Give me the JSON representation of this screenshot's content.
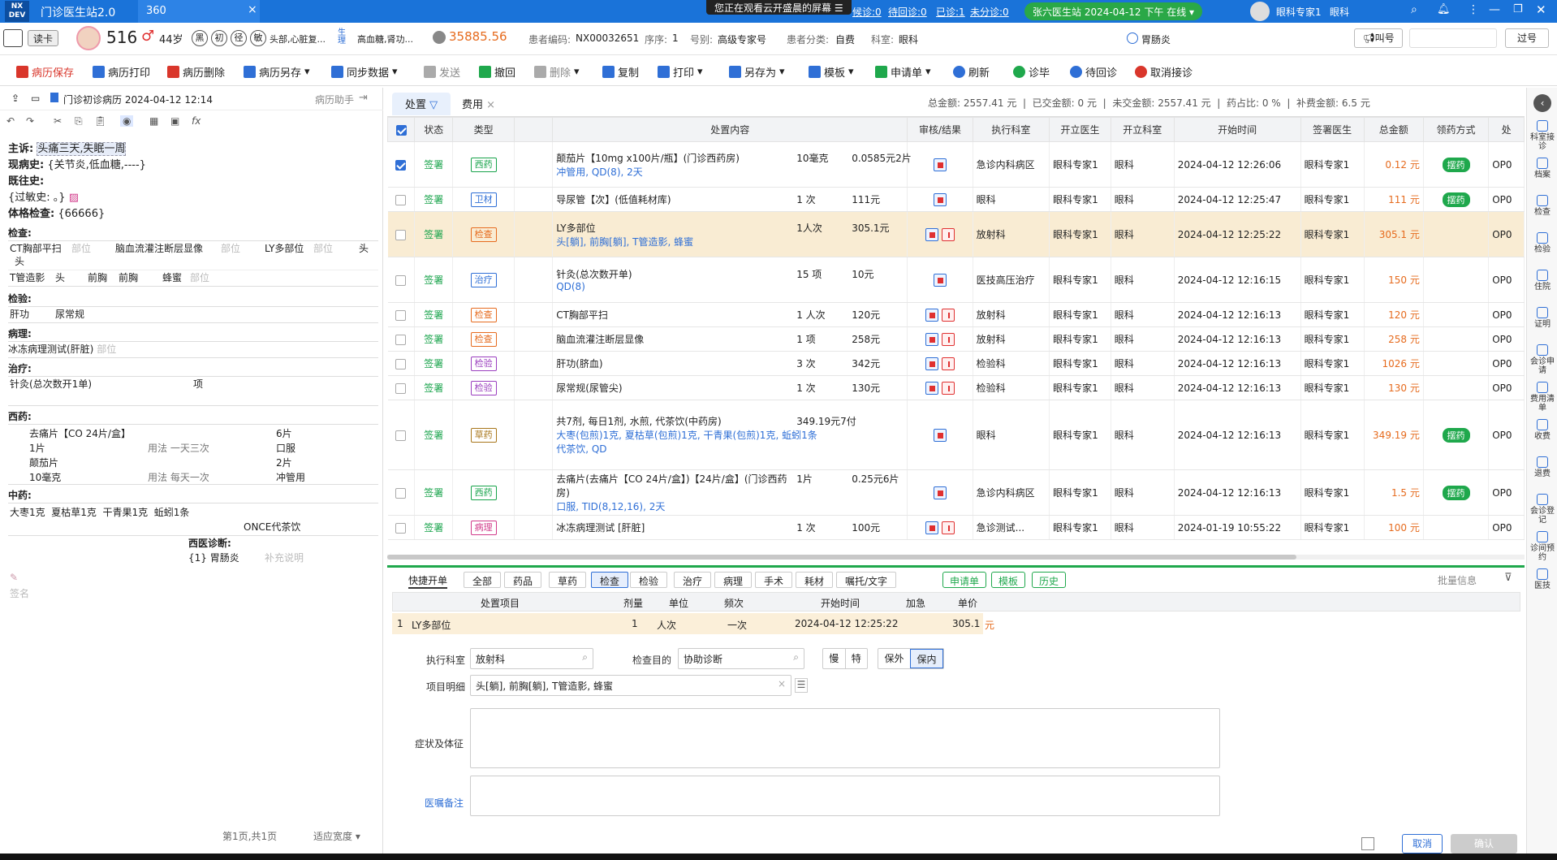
{
  "titlebar": {
    "logo": "NX DEV",
    "app_title": "门诊医生站2.0",
    "tab2_label": "360",
    "share_notice": "您正在观看云开盛晨的屏幕",
    "counts": [
      "候诊:0",
      "待回诊:0",
      "已诊:1",
      "未分诊:0"
    ],
    "online_label": "张六医生站 2024-04-12 下午",
    "online_status": "在线",
    "user_label": "眼科专家1",
    "user_dept": "眼科"
  },
  "patient": {
    "read_card": "读卡",
    "visit_num": "516",
    "gender_symbol": "♂",
    "age": "44岁",
    "badges": [
      "黑",
      "初",
      "径",
      "敏"
    ],
    "allergy": "头部,心脏复...",
    "diag": "高血糖,肾功...",
    "balance": "35885.56",
    "code_label": "患者编码:",
    "code": "NX00032651",
    "seq_label": "序序:",
    "seq": "1",
    "reg_label": "号别:",
    "reg": "高级专家号",
    "cat_label": "患者分类:",
    "cat": "自费",
    "dept_label": "科室:",
    "dept": "眼科",
    "flag": "胃肠炎",
    "call_btn": "叫号",
    "pass_btn": "过号"
  },
  "toolbar": {
    "items": [
      {
        "label": "病历保存",
        "color": "#d9362b"
      },
      {
        "label": "病历打印",
        "color": "#2f6fd6"
      },
      {
        "label": "病历删除",
        "color": "#d9362b"
      },
      {
        "label": "病历另存",
        "color": "#2f6fd6"
      },
      {
        "label": "同步数据",
        "color": "#2f6fd6"
      },
      {
        "label": "发送",
        "color": "#777777"
      },
      {
        "label": "撤回",
        "color": "#1fa84c"
      },
      {
        "label": "删除",
        "color": "#777777"
      },
      {
        "label": "复制",
        "color": "#2f6fd6"
      },
      {
        "label": "打印",
        "color": "#2f6fd6"
      },
      {
        "label": "另存为",
        "color": "#2f6fd6"
      },
      {
        "label": "模板",
        "color": "#2f6fd6"
      },
      {
        "label": "申请单",
        "color": "#1fa84c"
      },
      {
        "label": "刷新",
        "color": "#2f6fd6"
      },
      {
        "label": "诊毕",
        "color": "#1fa84c"
      },
      {
        "label": "待回诊",
        "color": "#2f6fd6"
      },
      {
        "label": "取消接诊",
        "color": "#d9362b"
      }
    ]
  },
  "record": {
    "title": "门诊初诊病历 2024-04-12 12:14",
    "assistant": "病历助手",
    "chief_label": "主诉:",
    "chief": "头痛三天,失眠一周",
    "hpi_label": "现病史:",
    "hpi": "{关节炎,低血糖,----}",
    "past_label": "既往史:",
    "allergy_label": "{过敏史:",
    "allergy_val": "。}",
    "exam_label": "体格检查:",
    "exam_val": "{66666}",
    "check_label": "检查:",
    "checks": [
      "CT胸部平扫",
      "脑血流灌注断层显像",
      "LY多部位",
      "T管造影",
      "头",
      "前胸",
      "前胸",
      "蜂蜜"
    ],
    "lab_label": "检验:",
    "labs": [
      "肝功",
      "尿常规"
    ],
    "path_label": "病理:",
    "path_val": "冰冻病理测试(肝脏)",
    "treat_label": "治疗:",
    "treat_val": "针灸(总次数开1单)",
    "treat_unit": "项",
    "west_label": "西药:",
    "west": [
      [
        "去痛片【CO 24片/盒】",
        "6片"
      ],
      [
        "1片",
        "用法 一天三次",
        "口服"
      ],
      [
        "颠茄片",
        "2片"
      ],
      [
        "10毫克",
        "用法 每天一次",
        "冲管用"
      ]
    ],
    "chinese_label": "中药:",
    "chinese": "大枣1克  夏枯草1克  干青果1克  蚯蚓1条",
    "chinese_note": "ONCE代茶饮",
    "diag_label": "西医诊断:",
    "diag_val": "{1} 胃肠炎",
    "diag_hint": "补充说明",
    "sign_label": "签名",
    "pager": "第1页,共1页",
    "fit": "适应宽度",
    "placeholder": "部位"
  },
  "tabs": {
    "t1": "处置",
    "t2": "费用",
    "total_label": "总金额:",
    "total": "2557.41",
    "paid_label": "已交金额:",
    "paid": "0",
    "unpaid_label": "未交金额:",
    "unpaid": "2557.41",
    "ratio_label": "药占比:",
    "ratio": "0 %",
    "supp_label": "补费金额:",
    "supp": "6.5",
    "yuan": "元"
  },
  "grid": {
    "headers": [
      "状态",
      "类型",
      "处置内容",
      "审核/结果",
      "执行科室",
      "开立医生",
      "开立科室",
      "开始时间",
      "签署医生",
      "总金额",
      "领药方式",
      "处"
    ],
    "rows": [
      {
        "status": "签署",
        "type": "西药",
        "tcolor": "#17a34a",
        "content": "颠茄片【10mg x100片/瓶】(门诊西药房)",
        "sub": "冲管用, QD(8), 2天",
        "qty": "10毫克",
        "price": "0.0585元2片",
        "exec": "急诊内科病区",
        "doc": "眼科专家1",
        "dept": "眼科",
        "time": "2024-04-12 12:26:06",
        "sign": "眼科专家1",
        "amount": "0.12 元",
        "pick": "摆药",
        "code": "OP0"
      },
      {
        "status": "签署",
        "type": "卫材",
        "tcolor": "#2f6fd6",
        "content": "导尿管【次】(低值耗材库)",
        "sub": "",
        "qty": "1 次",
        "price": "111元",
        "exec": "眼科",
        "doc": "眼科专家1",
        "dept": "眼科",
        "time": "2024-04-12 12:25:47",
        "sign": "眼科专家1",
        "amount": "111 元",
        "pick": "摆药",
        "code": "OP0"
      },
      {
        "status": "签署",
        "type": "检查",
        "tcolor": "#e66b1e",
        "content": "LY多部位",
        "sub": "头[躺], 前胸[躺], T管造影, 蜂蜜",
        "qty": "1人次",
        "price": "305.1元",
        "exec": "放射科",
        "doc": "眼科专家1",
        "dept": "眼科",
        "time": "2024-04-12 12:25:22",
        "sign": "眼科专家1",
        "amount": "305.1 元",
        "pick": "",
        "code": "OP0"
      },
      {
        "status": "签署",
        "type": "治疗",
        "tcolor": "#2f6fd6",
        "content": "针灸(总次数开单)",
        "sub": "QD(8)",
        "qty": "15 项",
        "price": "10元",
        "exec": "医技高压治疗",
        "doc": "眼科专家1",
        "dept": "眼科",
        "time": "2024-04-12 12:16:15",
        "sign": "眼科专家1",
        "amount": "150 元",
        "pick": "",
        "code": "OP0"
      },
      {
        "status": "签署",
        "type": "检查",
        "tcolor": "#e66b1e",
        "content": "CT胸部平扫",
        "sub": "",
        "qty": "1 人次",
        "price": "120元",
        "exec": "放射科",
        "doc": "眼科专家1",
        "dept": "眼科",
        "time": "2024-04-12 12:16:13",
        "sign": "眼科专家1",
        "amount": "120 元",
        "pick": "",
        "code": "OP0"
      },
      {
        "status": "签署",
        "type": "检查",
        "tcolor": "#e66b1e",
        "content": "脑血流灌注断层显像",
        "sub": "",
        "qty": "1 项",
        "price": "258元",
        "exec": "放射科",
        "doc": "眼科专家1",
        "dept": "眼科",
        "time": "2024-04-12 12:16:13",
        "sign": "眼科专家1",
        "amount": "258 元",
        "pick": "",
        "code": "OP0"
      },
      {
        "status": "签署",
        "type": "检验",
        "tcolor": "#9b3fbf",
        "content": "肝功(脐血)",
        "sub": "",
        "qty": "3 次",
        "price": "342元",
        "exec": "检验科",
        "doc": "眼科专家1",
        "dept": "眼科",
        "time": "2024-04-12 12:16:13",
        "sign": "眼科专家1",
        "amount": "1026 元",
        "pick": "",
        "code": "OP0"
      },
      {
        "status": "签署",
        "type": "检验",
        "tcolor": "#9b3fbf",
        "content": "尿常规(尿管尖)",
        "sub": "",
        "qty": "1 次",
        "price": "130元",
        "exec": "检验科",
        "doc": "眼科专家1",
        "dept": "眼科",
        "time": "2024-04-12 12:16:13",
        "sign": "眼科专家1",
        "amount": "130 元",
        "pick": "",
        "code": "OP0"
      },
      {
        "status": "签署",
        "type": "草药",
        "tcolor": "#a8761a",
        "content": "共7剂, 每日1剂, 水煎, 代茶饮(中药房)",
        "sub": "大枣(包煎)1克, 夏枯草(包煎)1克, 干青果(包煎)1克, 蚯蚓1条",
        "sub2": "代茶饮, QD",
        "qty": "349.19元7付",
        "price": "",
        "exec": "眼科",
        "doc": "眼科专家1",
        "dept": "眼科",
        "time": "2024-04-12 12:16:13",
        "sign": "眼科专家1",
        "amount": "349.19 元",
        "pick": "摆药",
        "code": "OP0"
      },
      {
        "status": "签署",
        "type": "西药",
        "tcolor": "#17a34a",
        "content": "去痛片(去痛片【CO 24片/盒】)【24片/盒】(门诊西药房)",
        "sub": "口服, TID(8,12,16), 2天",
        "qty": "1片",
        "price": "0.25元6片",
        "exec": "急诊内科病区",
        "doc": "眼科专家1",
        "dept": "眼科",
        "time": "2024-04-12 12:16:13",
        "sign": "眼科专家1",
        "amount": "1.5 元",
        "pick": "摆药",
        "code": "OP0"
      },
      {
        "status": "签署",
        "type": "病理",
        "tcolor": "#d13a8a",
        "content": "冰冻病理测试 [肝脏]",
        "sub": "",
        "qty": "1 次",
        "price": "100元",
        "exec": "急诊测试...",
        "doc": "眼科专家1",
        "dept": "眼科",
        "time": "2024-01-19 10:55:22",
        "sign": "眼科专家1",
        "amount": "100 元",
        "pick": "",
        "code": "OP0"
      }
    ]
  },
  "quick": {
    "title": "快捷开单",
    "tabs": [
      "全部",
      "药品",
      "草药",
      "检查",
      "检验",
      "治疗",
      "病理",
      "手术",
      "耗材",
      "嘱托/文字"
    ],
    "actions": [
      "申请单",
      "模板",
      "历史"
    ],
    "batch": "批量信息",
    "headers": [
      "处置项目",
      "剂量",
      "单位",
      "频次",
      "开始时间",
      "加急",
      "单价"
    ],
    "row": {
      "idx": "1",
      "item": "LY多部位",
      "dose": "1",
      "unit": "人次",
      "freq": "一次",
      "time": "2024-04-12 12:25:22",
      "price": "305.1",
      "yuan": "元"
    },
    "exec_label": "执行科室",
    "exec_val": "放射科",
    "purpose_label": "检查目的",
    "purpose_val": "协助诊断",
    "opts": [
      "慢",
      "特",
      "保外",
      "保内"
    ],
    "detail_label": "项目明细",
    "detail_val": "头[躺], 前胸[躺], T管造影, 蜂蜜",
    "symptom_label": "症状及体征",
    "remark_label": "医嘱备注",
    "cancel": "取消",
    "confirm": "确认"
  },
  "sidebar": [
    "科室接诊",
    "档案",
    "检查",
    "检验",
    "住院",
    "证明",
    "会诊申请",
    "费用清单",
    "收费",
    "退费",
    "会诊登记",
    "诊间预约",
    "医技"
  ]
}
